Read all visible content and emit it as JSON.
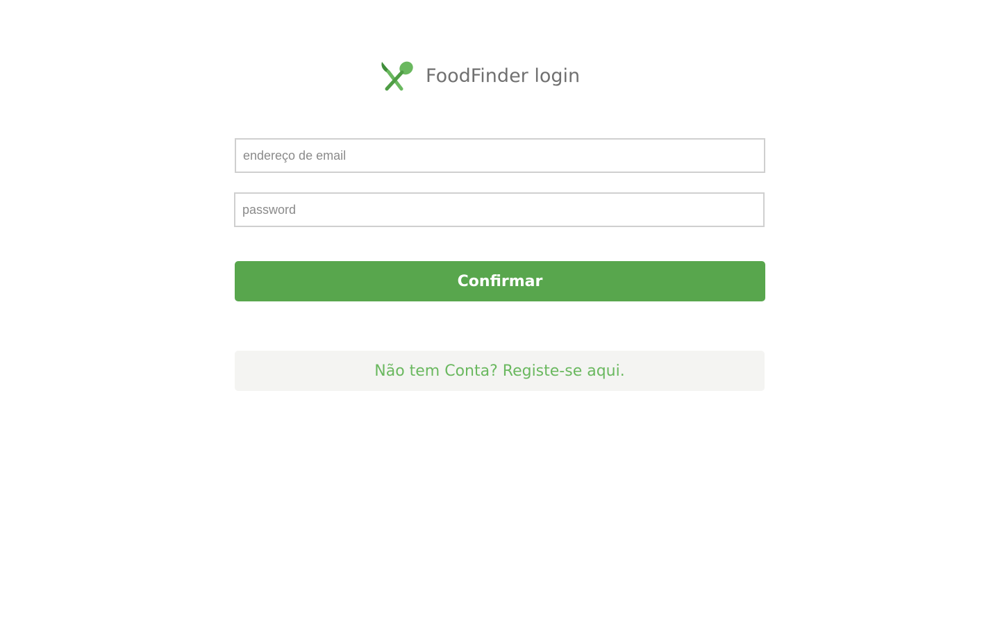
{
  "header": {
    "title": "FoodFinder login",
    "logo_icon": "fork-spoon-crossed-icon"
  },
  "form": {
    "email_placeholder": "endereço de email",
    "email_value": "",
    "password_placeholder": "password",
    "password_value": "",
    "confirm_label": "Confirmar"
  },
  "footer": {
    "register_link": "Não tem Conta? Registe-se aqui."
  },
  "colors": {
    "brand_green": "#58a64d",
    "link_green": "#6ab85f",
    "title_gray": "#707070"
  }
}
